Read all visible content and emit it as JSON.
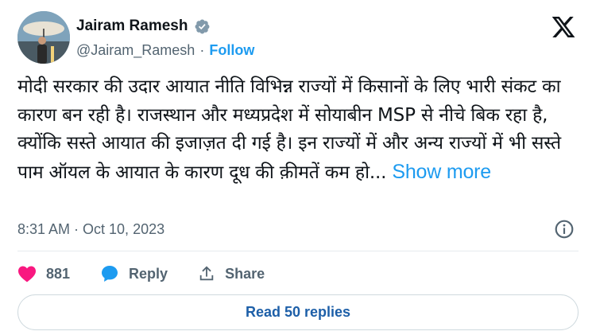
{
  "author": {
    "display_name": "Jairam Ramesh",
    "handle": "@Jairam_Ramesh",
    "separator": "·",
    "follow_label": "Follow",
    "verified_icon": "verified-badge-icon",
    "verified_color": "#829aab"
  },
  "brand": {
    "logo": "x-logo-icon"
  },
  "tweet": {
    "text": "मोदी सरकार की उदार आयात नीति विभिन्न राज्यों में किसानों के लिए भारी संकट का कारण बन रही है। राजस्थान और मध्यप्रदेश में सोयाबीन MSP से नीचे बिक रहा है, क्योंकि सस्ते आयात की इजाज़त दी गई है। इन राज्यों में और अन्य राज्यों में भी सस्ते पाम ऑयल के आयात के कारण दूध की क़ीमतें कम हो...",
    "show_more": "Show more",
    "timestamp": "8:31 AM · Oct 10, 2023"
  },
  "actions": {
    "like_count": "881",
    "reply_label": "Reply",
    "share_label": "Share"
  },
  "footer": {
    "read_replies_label": "Read 50 replies"
  },
  "colors": {
    "link": "#1d9bf0",
    "like": "#f91880",
    "reply": "#1d9bf0",
    "muted": "#536471",
    "text": "#0f1419"
  }
}
